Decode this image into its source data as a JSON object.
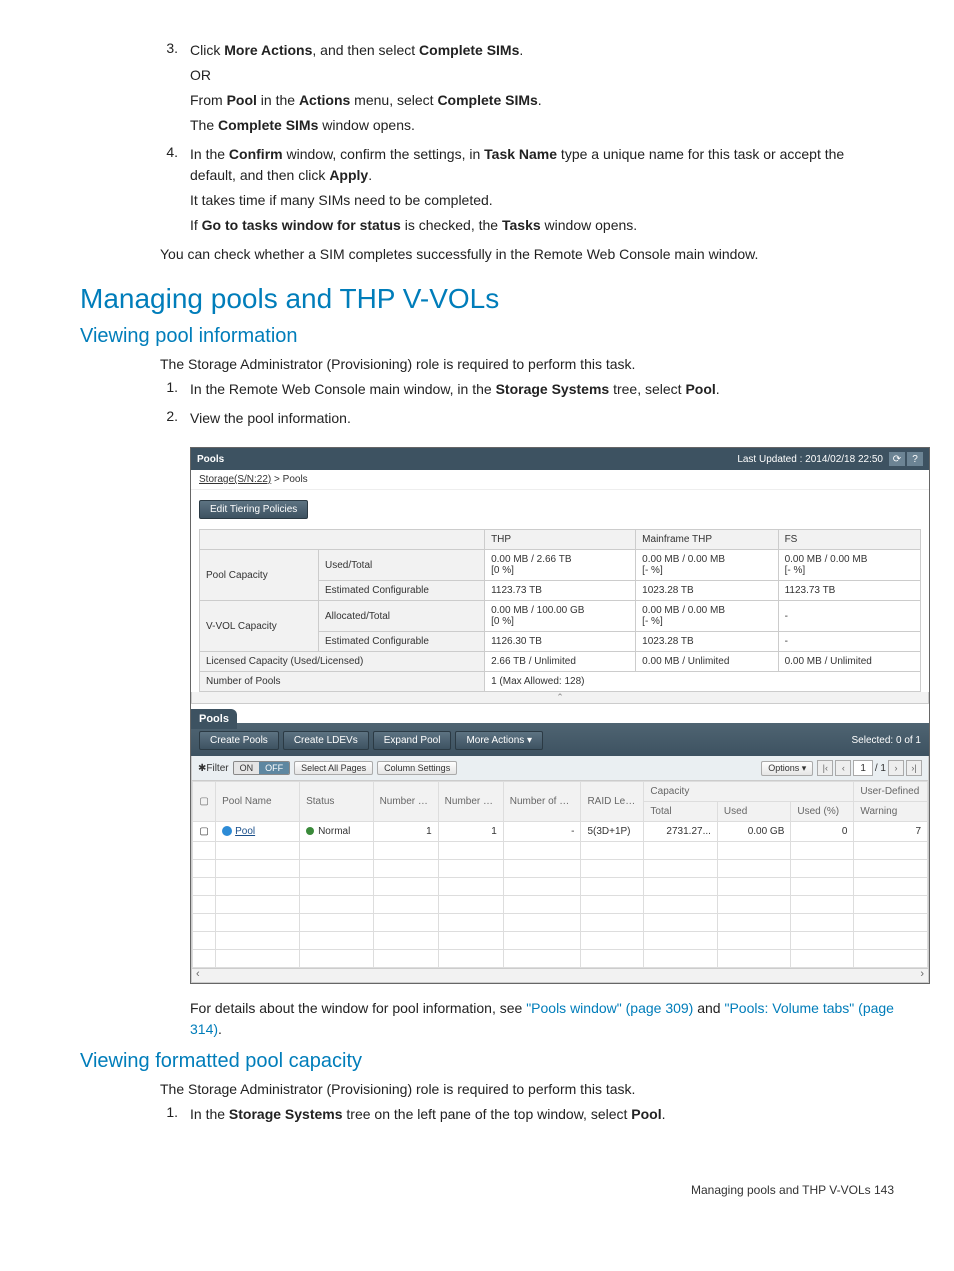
{
  "steps_a": [
    {
      "num": "3.",
      "lines": [
        {
          "parts": [
            "Click ",
            {
              "b": "More Actions"
            },
            ", and then select ",
            {
              "b": "Complete SIMs"
            },
            "."
          ]
        },
        {
          "parts": [
            "OR"
          ]
        },
        {
          "parts": [
            "From ",
            {
              "b": "Pool"
            },
            " in the ",
            {
              "b": "Actions"
            },
            " menu, select ",
            {
              "b": "Complete SIMs"
            },
            "."
          ]
        },
        {
          "parts": [
            "The ",
            {
              "b": "Complete SIMs"
            },
            " window opens."
          ]
        }
      ]
    },
    {
      "num": "4.",
      "lines": [
        {
          "parts": [
            "In the ",
            {
              "b": "Confirm"
            },
            " window, confirm the settings, in ",
            {
              "b": "Task Name"
            },
            " type a unique name for this task or accept the default, and then click ",
            {
              "b": "Apply"
            },
            "."
          ]
        },
        {
          "parts": [
            "It takes time if many SIMs need to be completed."
          ]
        },
        {
          "parts": [
            "If ",
            {
              "b": "Go to tasks window for status"
            },
            " is checked, the ",
            {
              "b": "Tasks"
            },
            " window opens."
          ]
        }
      ]
    }
  ],
  "post_a": "You can check whether a SIM completes successfully in the Remote Web Console main window.",
  "h1": "Managing pools and THP V-VOLs",
  "h2_1": "Viewing pool information",
  "intro_1": "The Storage Administrator (Provisioning) role is required to perform this task.",
  "steps_b": [
    {
      "num": "1.",
      "lines": [
        {
          "parts": [
            "In the Remote Web Console main window, in the ",
            {
              "b": "Storage Systems"
            },
            " tree, select ",
            {
              "b": "Pool"
            },
            "."
          ]
        }
      ]
    },
    {
      "num": "2.",
      "lines": [
        {
          "parts": [
            "View the pool information."
          ]
        }
      ]
    }
  ],
  "post_shot": {
    "pre": "For details about the window for pool information, see ",
    "link1": "\"Pools window\" (page 309)",
    "mid": " and ",
    "link2": "\"Pools: Volume tabs\" (page 314)",
    "tail": "."
  },
  "h2_2": "Viewing formatted pool capacity",
  "intro_2": "The Storage Administrator (Provisioning) role is required to perform this task.",
  "steps_c": [
    {
      "num": "1.",
      "lines": [
        {
          "parts": [
            "In the ",
            {
              "b": "Storage Systems"
            },
            " tree on the left pane of the top window, select ",
            {
              "b": "Pool"
            },
            "."
          ]
        }
      ]
    }
  ],
  "footer": "Managing pools and THP V-VOLs   143",
  "shot": {
    "title": "Pools",
    "updated": "Last Updated : 2014/02/18 22:50",
    "crumb_link": "Storage(S/N:22)",
    "crumb_current": "Pools",
    "tiering_btn": "Edit Tiering Policies",
    "cols": {
      "thp": "THP",
      "mf": "Mainframe THP",
      "fs": "FS"
    },
    "rows": {
      "pool_cap": "Pool Capacity",
      "used_total": "Used/Total",
      "est_conf": "Estimated Configurable",
      "vvol_cap": "V-VOL Capacity",
      "alloc_total": "Allocated/Total",
      "lic": "Licensed Capacity (Used/Licensed)",
      "numpools": "Number of Pools"
    },
    "vals": {
      "thp_used": "0.00 MB / 2.66 TB",
      "thp_used_pct": "[0 %]",
      "thp_est": "1123.73 TB",
      "thp_alloc": "0.00 MB / 100.00 GB",
      "thp_alloc_pct": "[0 %]",
      "thp_est2": "1126.30 TB",
      "thp_lic": "2.66 TB / Unlimited",
      "thp_np": "1 (Max Allowed: 128)",
      "mf_used": "0.00 MB / 0.00 MB",
      "mf_used_pct": "[- %]",
      "mf_est": "1023.28 TB",
      "mf_alloc": "0.00 MB / 0.00 MB",
      "mf_alloc_pct": "[- %]",
      "mf_est2": "1023.28 TB",
      "mf_lic": "0.00 MB / Unlimited",
      "fs_used": "0.00 MB / 0.00 MB",
      "fs_used_pct": "[- %]",
      "fs_est": "1123.73 TB",
      "fs_alloc": "-",
      "fs_est2": "-",
      "fs_lic": "0.00 MB / Unlimited"
    },
    "tab": "Pools",
    "toolbar": {
      "create_pools": "Create Pools",
      "create_ldevs": "Create LDEVs",
      "expand": "Expand Pool",
      "more": "More Actions",
      "selected": "Selected: 0  of 1"
    },
    "filter": {
      "label": "✱Filter",
      "on": "ON",
      "off": "OFF",
      "select_all": "Select All Pages",
      "colset": "Column Settings",
      "options": "Options ▾",
      "page": "1",
      "pageof": "/ 1"
    },
    "grid": {
      "hdr": {
        "pool": "Pool Name",
        "status": "Status",
        "nvols": "Number of Pool VOLs",
        "nvvols": "Number of V-VOLs",
        "nprim": "Number of Primary VOLs",
        "raid": "RAID Level",
        "cap": "Capacity",
        "total": "Total",
        "used": "Used",
        "usedpct": "Used (%)",
        "udef": "User-Defined",
        "warn": "Warning"
      },
      "row": {
        "pool": "Pool",
        "status": "Normal",
        "nvols": "1",
        "nvvols": "1",
        "nprim": "-",
        "raid": "5(3D+1P)",
        "total": "2731.27...",
        "used": "0.00 GB",
        "usedpct": "0",
        "warn": "7"
      }
    }
  }
}
